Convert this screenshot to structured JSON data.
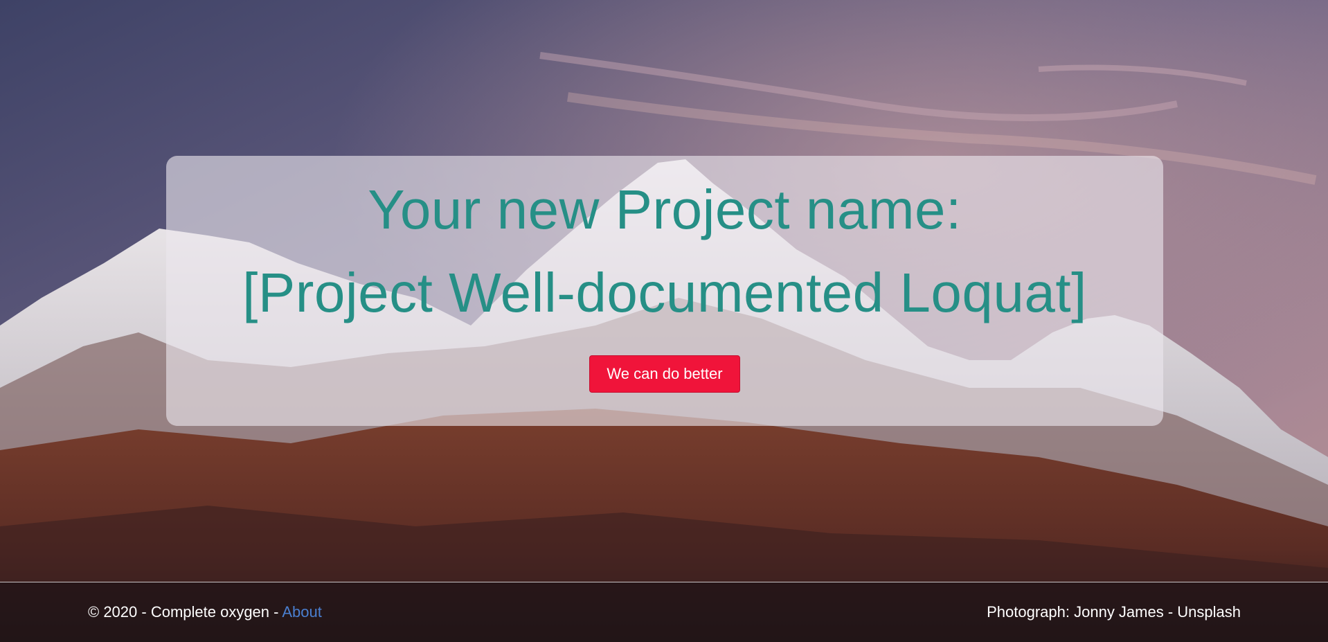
{
  "hero": {
    "title": "Your new Project name:",
    "project_name": "[Project Well-documented Loquat]",
    "cta_label": "We can do better"
  },
  "footer": {
    "copyright": "© 2020 - Complete oxygen - ",
    "about_link": "About",
    "photo_credit": "Photograph: Jonny James - Unsplash"
  },
  "colors": {
    "accent": "#268f86",
    "button": "#f0143a",
    "link": "#4a7fd0"
  }
}
